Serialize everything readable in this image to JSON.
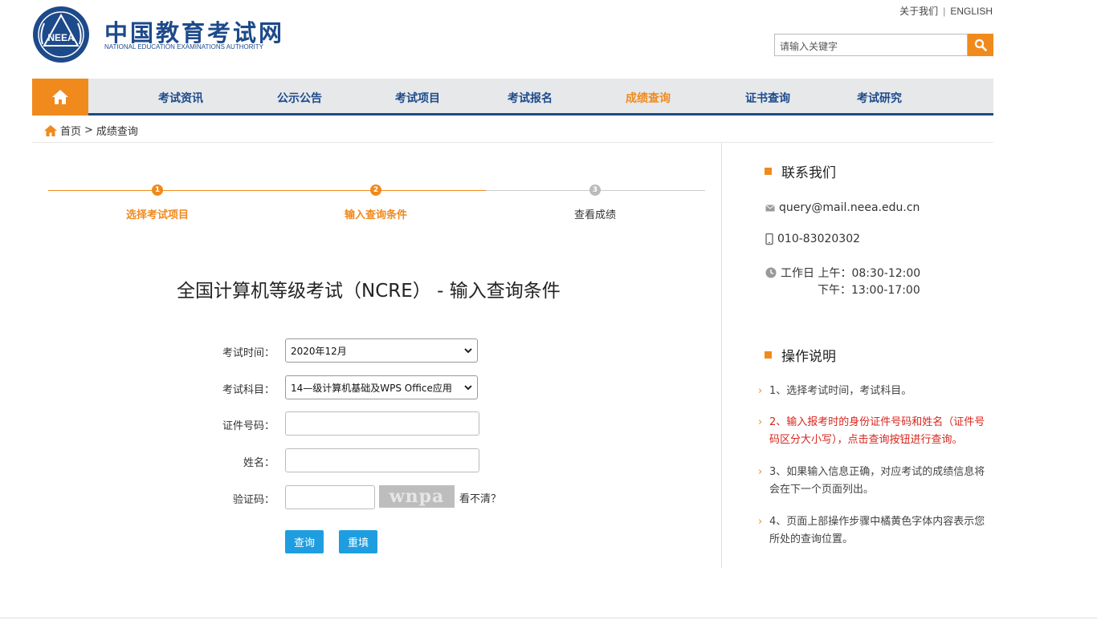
{
  "header": {
    "logo_text": "NEEA",
    "title": "中国教育考试网",
    "subtitle": "NATIONAL EDUCATION EXAMINATIONS AUTHORITY",
    "top_links": [
      "关于我们",
      "ENGLISH"
    ],
    "search_placeholder": "请输入关键字"
  },
  "nav": {
    "items": [
      "考试资讯",
      "公示公告",
      "考试项目",
      "考试报名",
      "成绩查询",
      "证书查询",
      "考试研究"
    ],
    "active_index": 4
  },
  "breadcrumb": {
    "home": "首页",
    "separator": ">",
    "current": "成绩查询"
  },
  "steps": [
    {
      "num": "1",
      "label": "选择考试项目",
      "state": "done"
    },
    {
      "num": "2",
      "label": "输入查询条件",
      "state": "current"
    },
    {
      "num": "3",
      "label": "查看成绩",
      "state": "pending"
    }
  ],
  "form": {
    "title": "全国计算机等级考试（NCRE） - 输入查询条件",
    "exam_time_label": "考试时间：",
    "exam_time_value": "2020年12月",
    "subject_label": "考试科目：",
    "subject_value": "14—级计算机基础及WPS Office应用",
    "id_label": "证件号码：",
    "id_value": "",
    "name_label": "姓名：",
    "name_value": "",
    "captcha_label": "验证码：",
    "captcha_value": "",
    "captcha_text": "wnpa",
    "captcha_refresh": "看不清？",
    "submit_label": "查询",
    "reset_label": "重填"
  },
  "contact": {
    "heading": "联系我们",
    "email": "query@mail.neea.edu.cn",
    "phone": "010-83020302",
    "hours_line1": "工作日 上午：08:30-12:00",
    "hours_line2": "下午：13:00-17:00"
  },
  "instructions": {
    "heading": "操作说明",
    "items": [
      "1、选择考试时间，考试科目。",
      "2、输入报考时的身份证件号码和姓名（证件号码区分大小写），点击查询按钮进行查询。",
      "3、如果输入信息正确，对应考试的成绩信息将会在下一个页面列出。",
      "4、页面上部操作步骤中橘黄色字体内容表示您所处的查询位置。"
    ]
  },
  "colors": {
    "brand_blue": "#1d4a8a",
    "accent_orange": "#f08a1d",
    "button_blue": "#1e9ee0",
    "highlight_red": "#d9251d"
  }
}
